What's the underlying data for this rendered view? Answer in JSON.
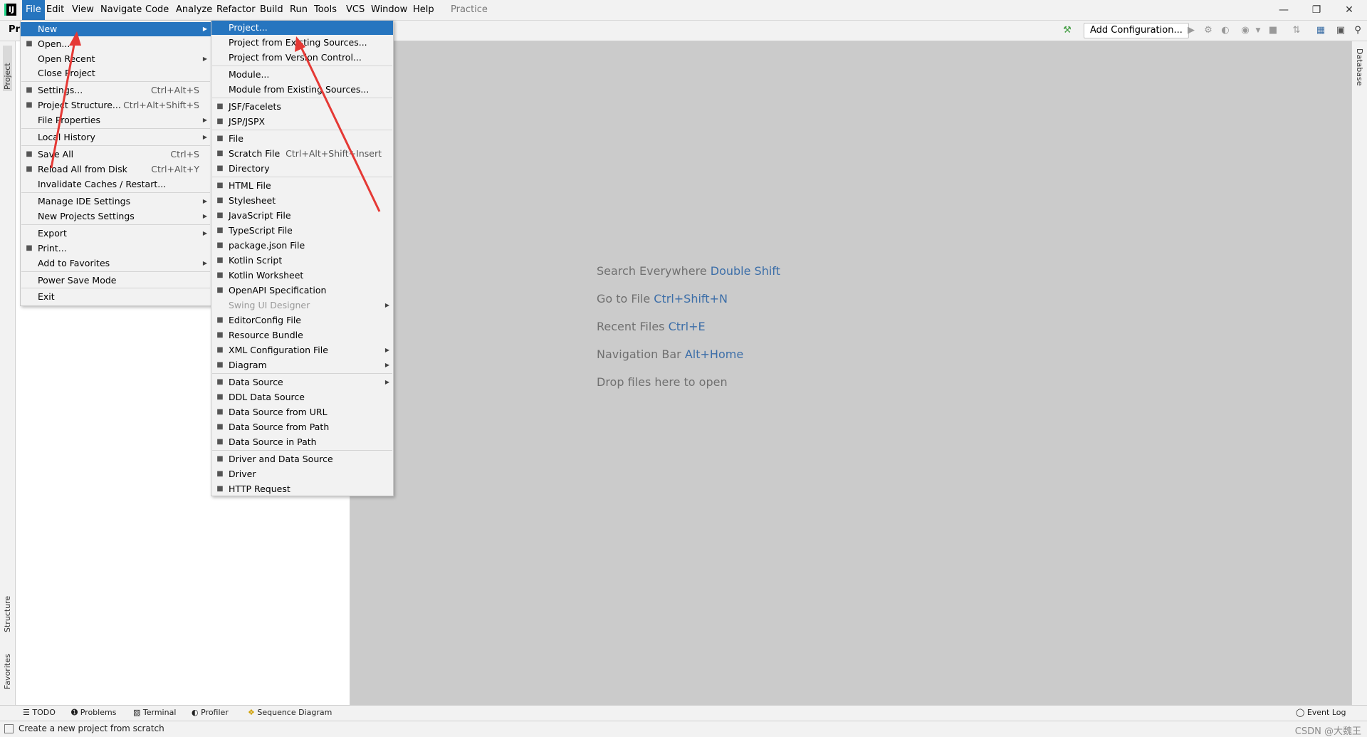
{
  "app": {
    "logo": "IJ",
    "project_title": "Practice"
  },
  "menubar": {
    "items": [
      "File",
      "Edit",
      "View",
      "Navigate",
      "Code",
      "Analyze",
      "Refactor",
      "Build",
      "Run",
      "Tools",
      "VCS",
      "Window",
      "Help"
    ]
  },
  "toolbar": {
    "nav_label": "Pra",
    "add_config": "Add Configuration..."
  },
  "side_tabs": {
    "project": "Project",
    "structure": "Structure",
    "favorites": "Favorites",
    "database": "Database"
  },
  "file_menu": {
    "items": [
      {
        "label": "New",
        "shortcut": "",
        "submenu": true,
        "icon": ""
      },
      {
        "label": "Open...",
        "shortcut": "",
        "submenu": false,
        "icon": "folder-icon"
      },
      {
        "label": "Open Recent",
        "shortcut": "",
        "submenu": true,
        "icon": ""
      },
      {
        "label": "Close Project",
        "shortcut": "",
        "submenu": false,
        "icon": ""
      },
      {
        "label": "Settings...",
        "shortcut": "Ctrl+Alt+S",
        "submenu": false,
        "icon": "wrench-icon"
      },
      {
        "label": "Project Structure...",
        "shortcut": "Ctrl+Alt+Shift+S",
        "submenu": false,
        "icon": "structure-icon"
      },
      {
        "label": "File Properties",
        "shortcut": "",
        "submenu": true,
        "icon": ""
      },
      {
        "label": "Local History",
        "shortcut": "",
        "submenu": true,
        "icon": ""
      },
      {
        "label": "Save All",
        "shortcut": "Ctrl+S",
        "submenu": false,
        "icon": "save-icon"
      },
      {
        "label": "Reload All from Disk",
        "shortcut": "Ctrl+Alt+Y",
        "submenu": false,
        "icon": "reload-icon"
      },
      {
        "label": "Invalidate Caches / Restart...",
        "shortcut": "",
        "submenu": false,
        "icon": ""
      },
      {
        "label": "Manage IDE Settings",
        "shortcut": "",
        "submenu": true,
        "icon": ""
      },
      {
        "label": "New Projects Settings",
        "shortcut": "",
        "submenu": true,
        "icon": ""
      },
      {
        "label": "Export",
        "shortcut": "",
        "submenu": true,
        "icon": ""
      },
      {
        "label": "Print...",
        "shortcut": "",
        "submenu": false,
        "icon": "print-icon"
      },
      {
        "label": "Add to Favorites",
        "shortcut": "",
        "submenu": true,
        "icon": ""
      },
      {
        "label": "Power Save Mode",
        "shortcut": "",
        "submenu": false,
        "icon": ""
      },
      {
        "label": "Exit",
        "shortcut": "",
        "submenu": false,
        "icon": ""
      }
    ]
  },
  "new_menu": {
    "items": [
      {
        "label": "Project...",
        "shortcut": "",
        "submenu": false,
        "icon": ""
      },
      {
        "label": "Project from Existing Sources...",
        "shortcut": "",
        "submenu": false,
        "icon": ""
      },
      {
        "label": "Project from Version Control...",
        "shortcut": "",
        "submenu": false,
        "icon": ""
      },
      {
        "label": "Module...",
        "shortcut": "",
        "submenu": false,
        "icon": ""
      },
      {
        "label": "Module from Existing Sources...",
        "shortcut": "",
        "submenu": false,
        "icon": ""
      },
      {
        "label": "JSF/Facelets",
        "shortcut": "",
        "submenu": false,
        "icon": "jsf-icon"
      },
      {
        "label": "JSP/JSPX",
        "shortcut": "",
        "submenu": false,
        "icon": "jsp-icon"
      },
      {
        "label": "File",
        "shortcut": "",
        "submenu": false,
        "icon": "file-icon"
      },
      {
        "label": "Scratch File",
        "shortcut": "Ctrl+Alt+Shift+Insert",
        "submenu": false,
        "icon": "scratch-icon"
      },
      {
        "label": "Directory",
        "shortcut": "",
        "submenu": false,
        "icon": "directory-icon"
      },
      {
        "label": "HTML File",
        "shortcut": "",
        "submenu": false,
        "icon": "html-icon"
      },
      {
        "label": "Stylesheet",
        "shortcut": "",
        "submenu": false,
        "icon": "css-icon"
      },
      {
        "label": "JavaScript File",
        "shortcut": "",
        "submenu": false,
        "icon": "js-icon"
      },
      {
        "label": "TypeScript File",
        "shortcut": "",
        "submenu": false,
        "icon": "ts-icon"
      },
      {
        "label": "package.json File",
        "shortcut": "",
        "submenu": false,
        "icon": "package-icon"
      },
      {
        "label": "Kotlin Script",
        "shortcut": "",
        "submenu": false,
        "icon": "kotlin-icon"
      },
      {
        "label": "Kotlin Worksheet",
        "shortcut": "",
        "submenu": false,
        "icon": "kotlin-worksheet-icon"
      },
      {
        "label": "OpenAPI Specification",
        "shortcut": "",
        "submenu": false,
        "icon": "openapi-icon"
      },
      {
        "label": "Swing UI Designer",
        "shortcut": "",
        "submenu": true,
        "icon": "",
        "disabled": true
      },
      {
        "label": "EditorConfig File",
        "shortcut": "",
        "submenu": false,
        "icon": "gear-icon"
      },
      {
        "label": "Resource Bundle",
        "shortcut": "",
        "submenu": false,
        "icon": "bundle-icon"
      },
      {
        "label": "XML Configuration File",
        "shortcut": "",
        "submenu": true,
        "icon": "xml-icon"
      },
      {
        "label": "Diagram",
        "shortcut": "",
        "submenu": true,
        "icon": "diagram-icon"
      },
      {
        "label": "Data Source",
        "shortcut": "",
        "submenu": true,
        "icon": "database-icon"
      },
      {
        "label": "DDL Data Source",
        "shortcut": "",
        "submenu": false,
        "icon": "ddl-icon"
      },
      {
        "label": "Data Source from URL",
        "shortcut": "",
        "submenu": false,
        "icon": "url-icon"
      },
      {
        "label": "Data Source from Path",
        "shortcut": "",
        "submenu": false,
        "icon": "folder-icon"
      },
      {
        "label": "Data Source in Path",
        "shortcut": "",
        "submenu": false,
        "icon": "database-icon"
      },
      {
        "label": "Driver and Data Source",
        "shortcut": "",
        "submenu": false,
        "icon": "driver-icon"
      },
      {
        "label": "Driver",
        "shortcut": "",
        "submenu": false,
        "icon": "driver-icon"
      },
      {
        "label": "HTTP Request",
        "shortcut": "",
        "submenu": false,
        "icon": "api-icon"
      }
    ]
  },
  "editor_hints": [
    {
      "text": "Search Everywhere",
      "key": "Double Shift"
    },
    {
      "text": "Go to File",
      "key": "Ctrl+Shift+N"
    },
    {
      "text": "Recent Files",
      "key": "Ctrl+E"
    },
    {
      "text": "Navigation Bar",
      "key": "Alt+Home"
    },
    {
      "text": "Drop files here to open",
      "key": ""
    }
  ],
  "bottom_tools": [
    "TODO",
    "Problems",
    "Terminal",
    "Profiler",
    "Sequence Diagram",
    "Event Log"
  ],
  "status": {
    "text": "Create a new project from scratch",
    "watermark": "CSDN @大魏王"
  },
  "colors": {
    "selection": "#2675bf",
    "hint_key": "#3c6ea8",
    "arrow": "#e53935",
    "editor_bg": "#cbcbcb"
  }
}
